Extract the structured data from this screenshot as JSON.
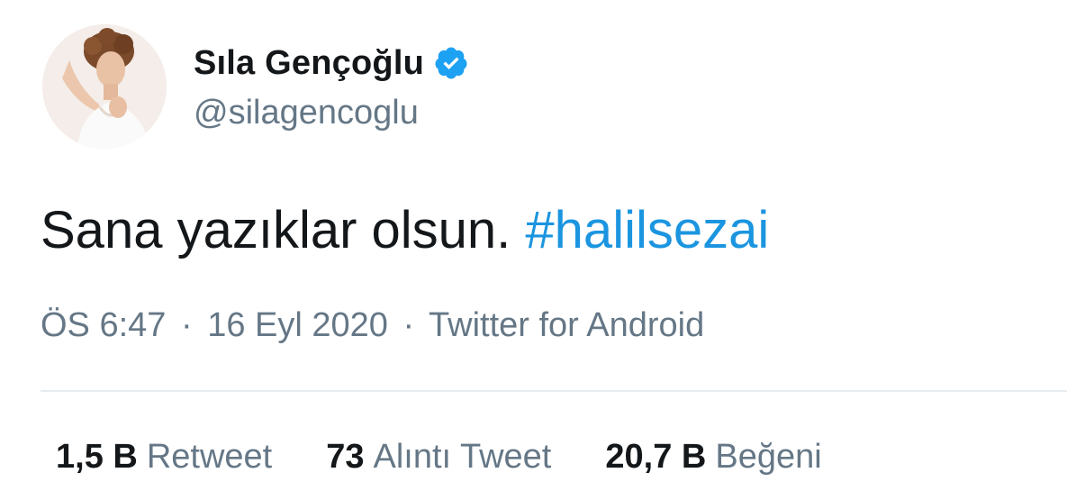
{
  "user": {
    "display_name": "Sıla Gençoğlu",
    "handle": "@silagencoglu",
    "verified": true
  },
  "tweet": {
    "text": "Sana yazıklar olsun.",
    "hashtag": "#halilsezai"
  },
  "meta": {
    "time": "ÖS 6:47",
    "separator": "·",
    "date": "16 Eyl 2020",
    "source": "Twitter for Android"
  },
  "stats": {
    "retweet_count": "1,5 B",
    "retweet_label": "Retweet",
    "quote_count": "73",
    "quote_label": "Alıntı Tweet",
    "like_count": "20,7 B",
    "like_label": "Beğeni"
  },
  "colors": {
    "hashtag": "#1b95e0",
    "verified_badge": "#1da1f2",
    "muted_text": "#657786"
  },
  "icons": {
    "verified": "verified-badge-icon"
  }
}
